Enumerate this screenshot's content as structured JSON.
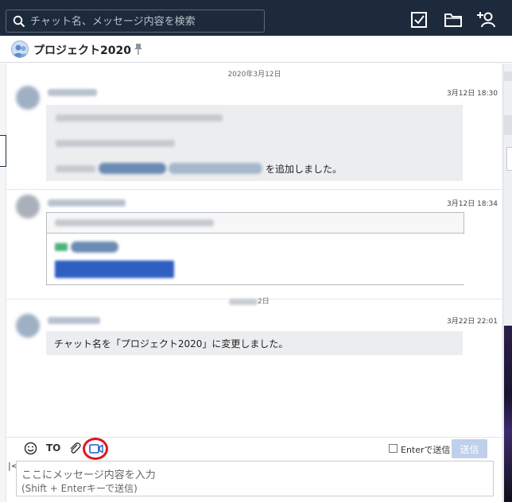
{
  "search": {
    "placeholder": "チャット名、メッセージ内容を検索"
  },
  "topbar_icons": [
    "task-check-icon",
    "folder-icon",
    "add-contact-icon"
  ],
  "room": {
    "title": "プロジェクト2020"
  },
  "chat": {
    "date_sep_1": "2020年3月12日",
    "date_sep_2_visible_suffix": "2日",
    "messages": [
      {
        "time": "3月12日 18:30",
        "visible_text": "を追加しました。"
      },
      {
        "time": "3月12日 18:34"
      },
      {
        "time": "3月22日 22:01",
        "text": "チャット名を「プロジェクト2020」に変更しました。"
      }
    ]
  },
  "composer": {
    "to_label": "TO",
    "enter_send_label": "Enterで送信",
    "send_label": "送信",
    "collapse_label": "|<",
    "placeholder_line1": "ここにメッセージ内容を入力",
    "placeholder_line2": "(Shift + Enterキーで送信)"
  },
  "colors": {
    "topbar": "#1c2a3b",
    "accent_red_circle": "#e0161c",
    "send_button": "#bfd0ea"
  }
}
